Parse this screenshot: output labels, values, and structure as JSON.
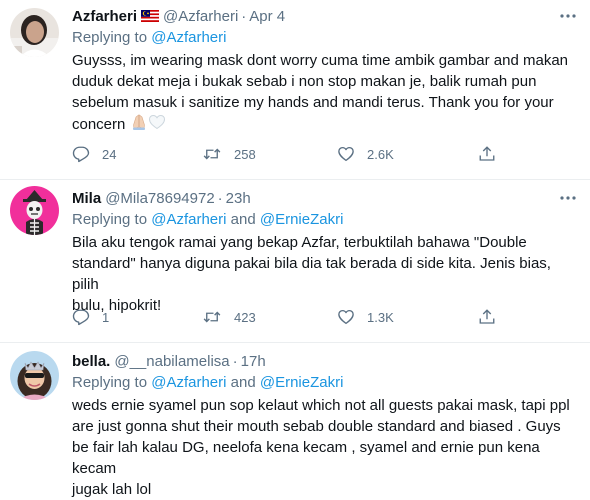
{
  "tweets": [
    {
      "name": "Azfarheri",
      "handle": "@Azfarheri",
      "separator": "·",
      "time": "Apr 4",
      "has_flag": true,
      "replying_prefix": "Replying to ",
      "mention1": "@Azfarheri",
      "and_word": "",
      "mention2": "",
      "text_lines": [
        "Guysss, im wearing mask dont worry cuma time ambik gambar and makan",
        "duduk dekat meja i bukak sebab i non stop makan je, balik rumah pun",
        "sebelum masuk i sanitize my hands and mandi terus. Thank you for your",
        "concern"
      ],
      "reply_count": "24",
      "retweet_count": "258",
      "like_count": "2.6K"
    },
    {
      "name": "Mila",
      "handle": "@Mila78694972",
      "separator": "·",
      "time": "23h",
      "has_flag": false,
      "replying_prefix": "Replying to ",
      "mention1": "@Azfarheri",
      "and_word": " and ",
      "mention2": "@ErnieZakri",
      "text_lines": [
        "Bila aku tengok ramai yang bekap Azfar, terbuktilah bahawa \"Double",
        "standard\" hanya diguna pakai bila dia tak berada di side kita. Jenis bias, pilih",
        "bulu, hipokrit!"
      ],
      "reply_count": "1",
      "retweet_count": "423",
      "like_count": "1.3K"
    },
    {
      "name": "bella.",
      "handle": "@__nabilamelisa",
      "separator": "·",
      "time": "17h",
      "has_flag": false,
      "replying_prefix": "Replying to ",
      "mention1": "@Azfarheri",
      "and_word": " and ",
      "mention2": "@ErnieZakri",
      "text_lines": [
        "weds ernie syamel pun sop kelaut which not all guests pakai mask,  tapi ppl",
        "are just gonna shut their mouth sebab double standard and biased . Guys",
        "be fair lah kalau DG, neelofa kena kecam , syamel and ernie pun kena kecam",
        "jugak lah lol"
      ]
    }
  ],
  "icons": {
    "reply": "reply-icon",
    "retweet": "retweet-icon",
    "like": "heart-icon",
    "share": "share-icon",
    "more": "more-icon",
    "flag": "malaysia-flag-icon",
    "emoji_pray": "folded-hands-emoji",
    "emoji_heart": "white-heart-emoji"
  },
  "colors": {
    "text": "#0f1419",
    "secondary": "#5b7083",
    "link": "#1b95e0",
    "divider": "#ebeef0"
  }
}
